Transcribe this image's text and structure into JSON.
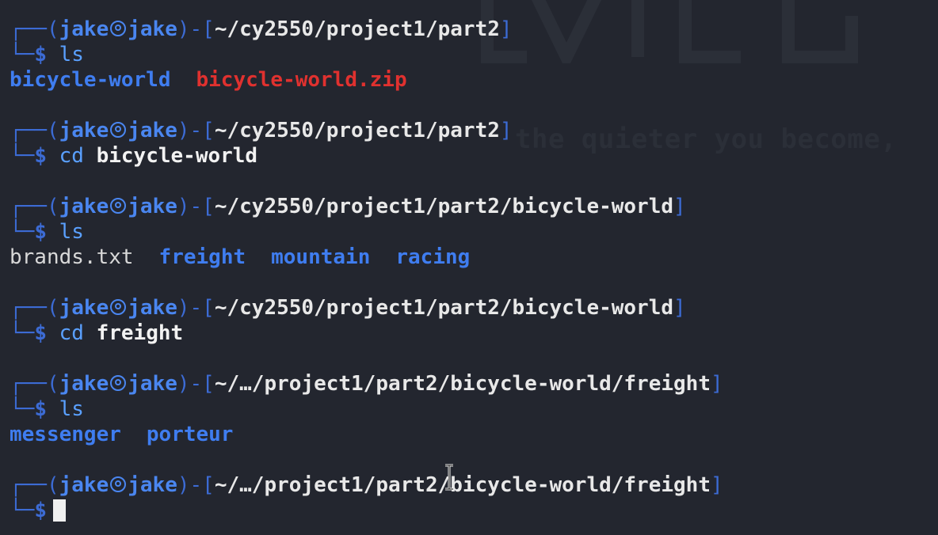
{
  "wallpaper": {
    "tagline": "the quieter you become,"
  },
  "prompt": {
    "frame_top": "┌──(",
    "user": "jake",
    "host": "jake",
    "mid": ")-[",
    "close": "]",
    "frame_bottom": "└─",
    "dollar": "$"
  },
  "blocks": [
    {
      "path": "~/cy2550/project1/part2",
      "cmd": "ls",
      "arg": "",
      "output": [
        {
          "text": "bicycle-world",
          "kind": "dir"
        },
        {
          "text": "bicycle-world.zip",
          "kind": "zip"
        }
      ]
    },
    {
      "path": "~/cy2550/project1/part2",
      "cmd": "cd",
      "arg": "bicycle-world",
      "output": []
    },
    {
      "path": "~/cy2550/project1/part2/bicycle-world",
      "cmd": "ls",
      "arg": "",
      "output": [
        {
          "text": "brands.txt",
          "kind": "file"
        },
        {
          "text": "freight",
          "kind": "dir"
        },
        {
          "text": "mountain",
          "kind": "dir"
        },
        {
          "text": "racing",
          "kind": "dir"
        }
      ]
    },
    {
      "path": "~/cy2550/project1/part2/bicycle-world",
      "cmd": "cd",
      "arg": "freight",
      "output": []
    },
    {
      "path": "~/…/project1/part2/bicycle-world/freight",
      "cmd": "ls",
      "arg": "",
      "output": [
        {
          "text": "messenger",
          "kind": "dir"
        },
        {
          "text": "porteur",
          "kind": "dir"
        }
      ]
    },
    {
      "path": "~/…/project1/part2/bicycle-world/freight",
      "cmd": "",
      "arg": "",
      "output": [],
      "active": true
    }
  ]
}
